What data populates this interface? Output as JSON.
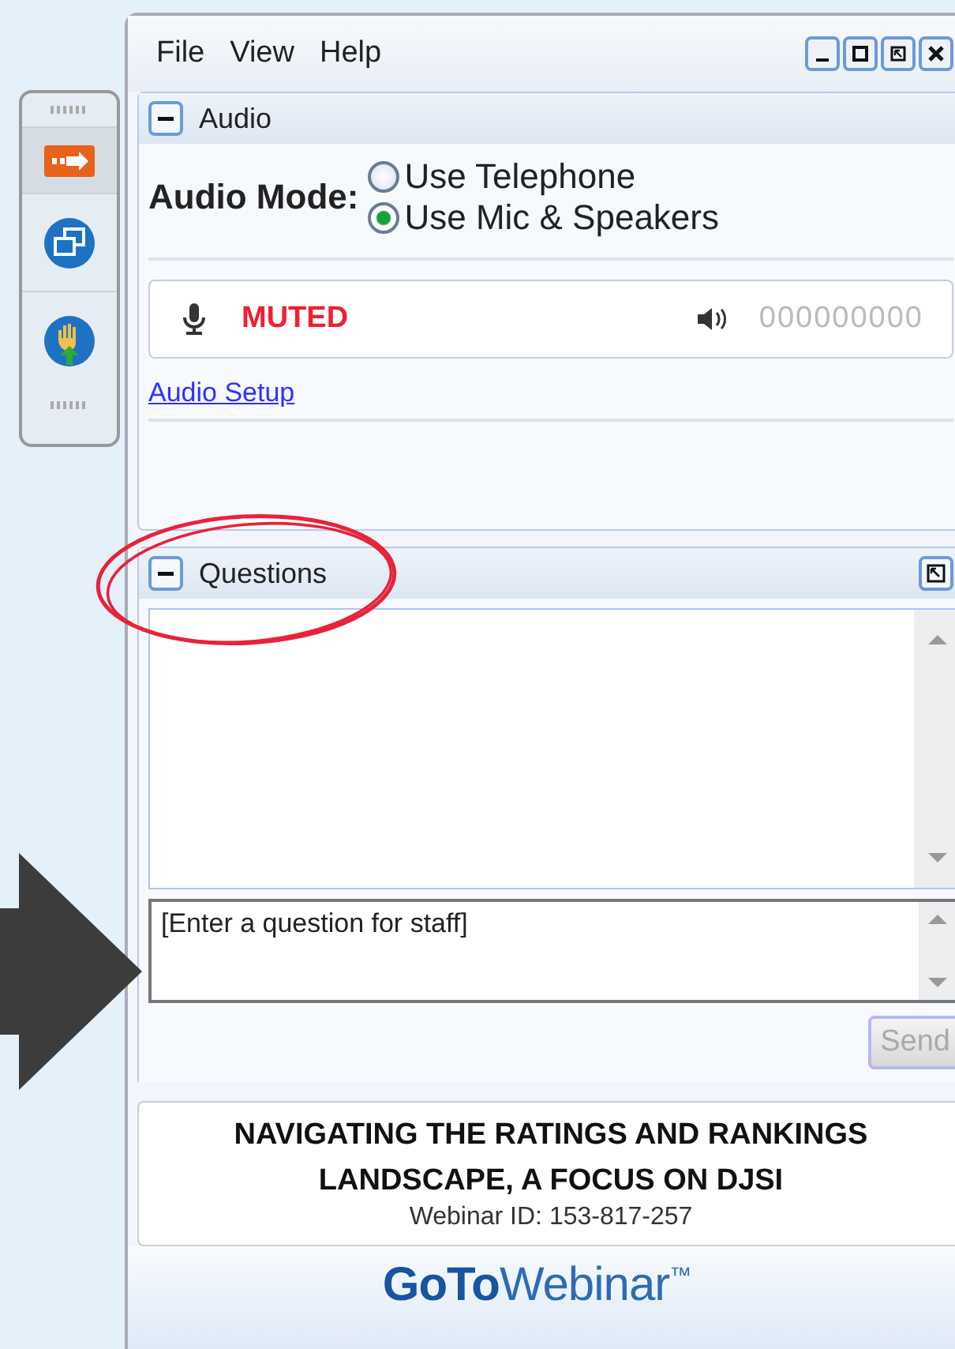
{
  "menu": [
    "File",
    "View",
    "Help"
  ],
  "audio": {
    "title": "Audio",
    "expanded": true,
    "mode_label": "Audio Mode:",
    "options": [
      {
        "label": "Use Telephone",
        "selected": false
      },
      {
        "label": "Use Mic & Speakers",
        "selected": true
      }
    ],
    "mic_status": "MUTED",
    "code": "000000000",
    "setup_link": "Audio Setup"
  },
  "questions": {
    "title": "Questions",
    "expanded": true,
    "placeholder": "[Enter a question for staff]",
    "send": "Send",
    "send_disabled": true
  },
  "webinar": {
    "title": "NAVIGATING THE RATINGS AND RANKINGS LANDSCAPE, A FOCUS ON DJSI",
    "id": "Webinar ID: 153-817-257"
  },
  "logo": "**GoTo**Webinar$^{™}$"
}
